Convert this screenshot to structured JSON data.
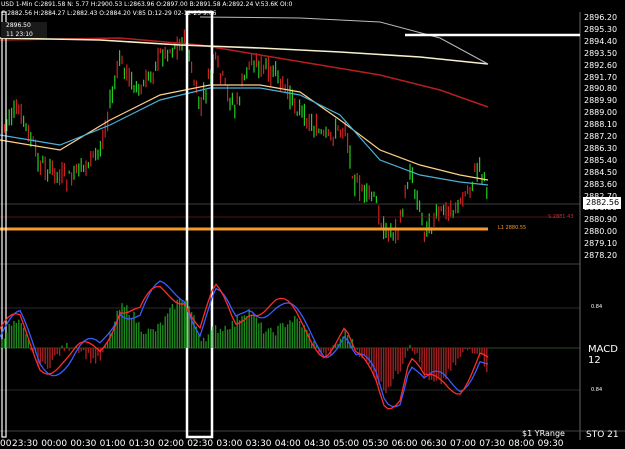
{
  "header": {
    "symbol_line": "USD  1-Min  C:2891.58  N:  5.77  H:2900.53  L:2863.96  O:2897.00  B:2891.58  A:2892.24  V:53.6K  OI:0",
    "ma_line": "C:2882.56  H:2884.27  L:2882.43  O:2884.20  V:85  D:12-29  02-12-25  9:06",
    "cursor_price": "2896.50",
    "cursor_time": "11 23:10"
  },
  "price_axis": {
    "ticks": [
      "2896.20",
      "2895.30",
      "2894.40",
      "2893.50",
      "2892.60",
      "2891.70",
      "2890.80",
      "2889.90",
      "2889.00",
      "2888.10",
      "2887.20",
      "2886.30",
      "2885.40",
      "2884.50",
      "2883.60",
      "2882.70",
      "2881.80",
      "2880.90",
      "2880.00",
      "2879.10",
      "2878.20"
    ],
    "last_price": "2882.56"
  },
  "annotations": {
    "level_label": "L1 2880.55",
    "small_label": "S 2881.43"
  },
  "indicator": {
    "name": "MACD 12",
    "upper_level": "0.84",
    "lower_level": "0.84",
    "bottom_left": "$1 YRange",
    "bottom_right": "STO 21"
  },
  "time_axis": [
    "00",
    "23:30",
    "00:00",
    "00:30",
    "01:00",
    "01:30",
    "02:00",
    "02:30",
    "03:00",
    "03:30",
    "04:00",
    "04:30",
    "05:00",
    "05:30",
    "06:00",
    "06:30",
    "07:00",
    "07:30",
    "08:00",
    "09:30"
  ],
  "colors": {
    "background": "#000000",
    "up_candle": "#22cc22",
    "down_candle": "#cc2222",
    "ma_fast": "#ffd28a",
    "ma_mid": "#4ab0d8",
    "ma_slow": "#b81e1e",
    "ma_long": "#f4f0cc",
    "level_line": "#f59a28",
    "macd_line": "#3a5cff",
    "signal_line": "#ff2b2b"
  }
}
